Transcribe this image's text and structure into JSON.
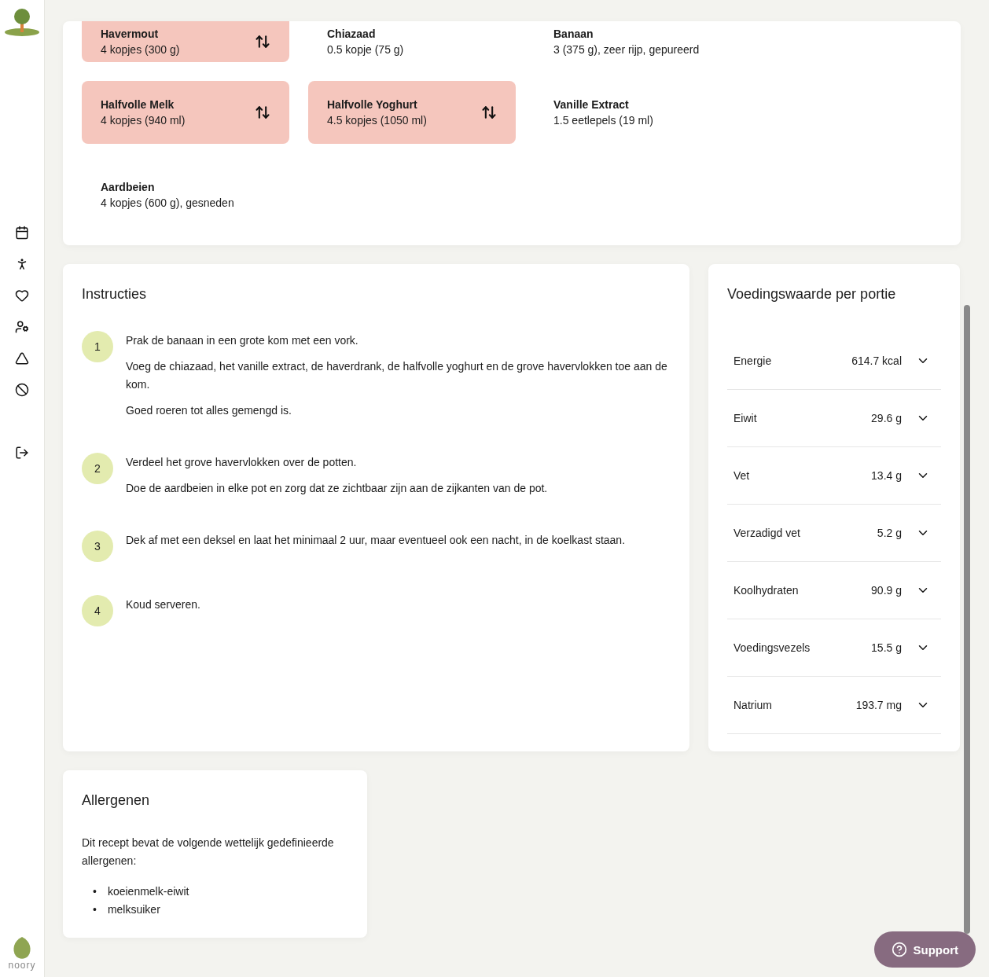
{
  "ingredients": [
    {
      "name": "Havermout",
      "amount": "4 kopjes (300 g)",
      "swappable": true
    },
    {
      "name": "Chiazaad",
      "amount": "0.5 kopje (75 g)",
      "swappable": false
    },
    {
      "name": "Banaan",
      "amount": "3 (375 g), zeer rijp, gepureerd",
      "swappable": false
    },
    {
      "name": "Halfvolle Melk",
      "amount": "4 kopjes (940 ml)",
      "swappable": true
    },
    {
      "name": "Halfvolle Yoghurt",
      "amount": "4.5 kopjes (1050 ml)",
      "swappable": true
    },
    {
      "name": "Vanille Extract",
      "amount": "1.5 eetlepels (19 ml)",
      "swappable": false
    },
    {
      "name": "Aardbeien",
      "amount": "4 kopjes (600 g), gesneden",
      "swappable": false
    }
  ],
  "instructions": {
    "title": "Instructies",
    "steps": [
      {
        "number": "1",
        "lines": [
          "Prak de banaan in een grote kom met een vork.",
          "Voeg de chiazaad, het vanille extract, de haverdrank, de halfvolle yoghurt en de grove havervlokken toe aan de kom.",
          "Goed roeren tot alles gemengd is."
        ]
      },
      {
        "number": "2",
        "lines": [
          "Verdeel het grove havervlokken over de potten.",
          "Doe de aardbeien in elke pot en zorg dat ze zichtbaar zijn aan de zijkanten van de pot."
        ]
      },
      {
        "number": "3",
        "lines": [
          "Dek af met een deksel en laat het minimaal 2 uur, maar eventueel ook een nacht, in de koelkast staan."
        ]
      },
      {
        "number": "4",
        "lines": [
          "Koud serveren."
        ]
      }
    ]
  },
  "nutrition": {
    "title": "Voedingswaarde per portie",
    "rows": [
      {
        "label": "Energie",
        "value": "614.7 kcal",
        "expanded": false
      },
      {
        "label": "Eiwit",
        "value": "29.6 g",
        "expanded": false
      },
      {
        "label": "Vet",
        "value": "13.4 g",
        "expanded": false
      },
      {
        "label": "Verzadigd vet",
        "value": "5.2 g",
        "expanded": false
      },
      {
        "label": "Koolhydraten",
        "value": "90.9 g",
        "expanded": false
      },
      {
        "label": "Voedingsvezels",
        "value": "15.5 g",
        "expanded": false
      },
      {
        "label": "Natrium",
        "value": "193.7 mg",
        "expanded": false
      }
    ]
  },
  "allergens": {
    "title": "Allergenen",
    "intro": "Dit recept bevat de volgende wettelijk gedefinieerde allergenen:",
    "items": [
      {
        "bullet": "•",
        "text": "koeienmelk-eiwit"
      },
      {
        "bullet": "•",
        "text": "melksuiker"
      }
    ]
  },
  "brand": "noory",
  "support": "Support"
}
